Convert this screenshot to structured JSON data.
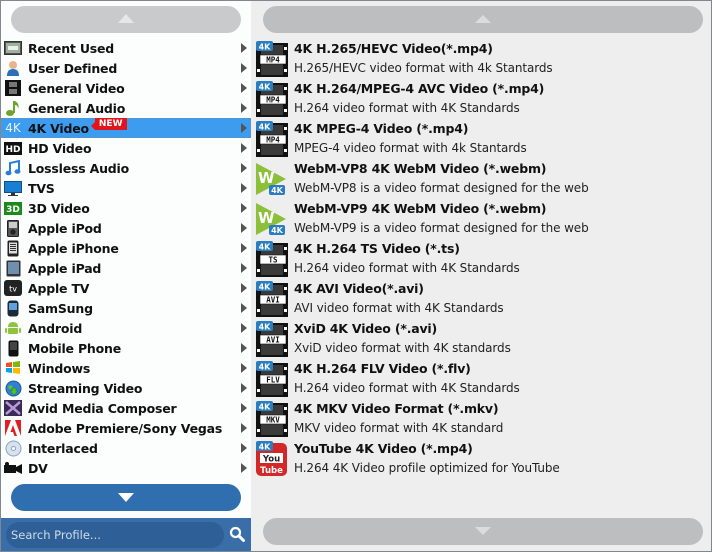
{
  "left_panel": {
    "scroll_up_icon": "triangle-up",
    "scroll_down_icon": "triangle-down",
    "categories": [
      {
        "label": "Recent Used",
        "icon": "recent-used-icon",
        "selected": false
      },
      {
        "label": "User Defined",
        "icon": "user-icon",
        "selected": false
      },
      {
        "label": "General Video",
        "icon": "film-strip-icon",
        "selected": false
      },
      {
        "label": "General Audio",
        "icon": "music-note-icon",
        "selected": false
      },
      {
        "label": "4K Video",
        "icon": "4k-icon",
        "selected": true,
        "badge": "NEW"
      },
      {
        "label": "HD Video",
        "icon": "hd-icon",
        "selected": false
      },
      {
        "label": "Lossless Audio",
        "icon": "lossless-audio-icon",
        "selected": false
      },
      {
        "label": "TVS",
        "icon": "tv-icon",
        "selected": false
      },
      {
        "label": "3D Video",
        "icon": "3d-icon",
        "selected": false
      },
      {
        "label": "Apple iPod",
        "icon": "ipod-icon",
        "selected": false
      },
      {
        "label": "Apple iPhone",
        "icon": "iphone-icon",
        "selected": false
      },
      {
        "label": "Apple iPad",
        "icon": "ipad-icon",
        "selected": false
      },
      {
        "label": "Apple TV",
        "icon": "apple-tv-icon",
        "selected": false
      },
      {
        "label": "SamSung",
        "icon": "samsung-phone-icon",
        "selected": false
      },
      {
        "label": "Android",
        "icon": "android-icon",
        "selected": false
      },
      {
        "label": "Mobile Phone",
        "icon": "mobile-phone-icon",
        "selected": false
      },
      {
        "label": "Windows",
        "icon": "windows-icon",
        "selected": false
      },
      {
        "label": "Streaming Video",
        "icon": "globe-download-icon",
        "selected": false
      },
      {
        "label": "Avid Media Composer",
        "icon": "avid-icon",
        "selected": false
      },
      {
        "label": "Adobe Premiere/Sony Vegas",
        "icon": "adobe-icon",
        "selected": false
      },
      {
        "label": "Interlaced",
        "icon": "disc-icon",
        "selected": false
      },
      {
        "label": "DV",
        "icon": "camcorder-icon",
        "selected": false
      }
    ],
    "search": {
      "placeholder": "Search Profile...",
      "value": "",
      "icon": "search-icon"
    }
  },
  "right_panel": {
    "formats": [
      {
        "name": "4K H.265/HEVC Video(*.mp4)",
        "desc": "H.265/HEVC video format with 4k Stantards",
        "icon": "film",
        "tag": "MP4"
      },
      {
        "name": "4K H.264/MPEG-4 AVC Video (*.mp4)",
        "desc": "H.264 video format with 4K Standards",
        "icon": "film",
        "tag": "MP4"
      },
      {
        "name": "4K MPEG-4 Video (*.mp4)",
        "desc": "MPEG-4 video format with 4k Stantards",
        "icon": "film",
        "tag": "MP4"
      },
      {
        "name": "WebM-VP8 4K WebM Video (*.webm)",
        "desc": "WebM-VP8 is a video format designed for the web",
        "icon": "webm",
        "tag": "W"
      },
      {
        "name": "WebM-VP9 4K WebM Video (*.webm)",
        "desc": "WebM-VP9 is a video format designed for the web",
        "icon": "webm",
        "tag": "W"
      },
      {
        "name": "4K H.264 TS Video (*.ts)",
        "desc": "H.264 video format with 4K Standards",
        "icon": "film",
        "tag": "TS"
      },
      {
        "name": "4K AVI Video(*.avi)",
        "desc": "AVI video format with 4K Standards",
        "icon": "film",
        "tag": "AVI"
      },
      {
        "name": "XviD 4K Video (*.avi)",
        "desc": "XviD video format with 4K standards",
        "icon": "film",
        "tag": "AVI"
      },
      {
        "name": "4K H.264 FLV Video (*.flv)",
        "desc": "H.264 video format with 4K Standards",
        "icon": "film",
        "tag": "FLV"
      },
      {
        "name": "4K MKV Video Format (*.mkv)",
        "desc": "MKV video format with 4K standard",
        "icon": "film",
        "tag": "MKV"
      },
      {
        "name": "YouTube 4K Video (*.mp4)",
        "desc": "H.264 4K Video profile optimized for YouTube",
        "icon": "youtube",
        "tag": "You Tube"
      }
    ],
    "badge_4k": "4K"
  },
  "colors": {
    "selection": "#3c9cf0",
    "scroll_down_active": "#2f6eaf",
    "search_bar": "#3a6ea8",
    "new_badge": "#e0161b",
    "badge_4k": "#2a7dc0"
  }
}
